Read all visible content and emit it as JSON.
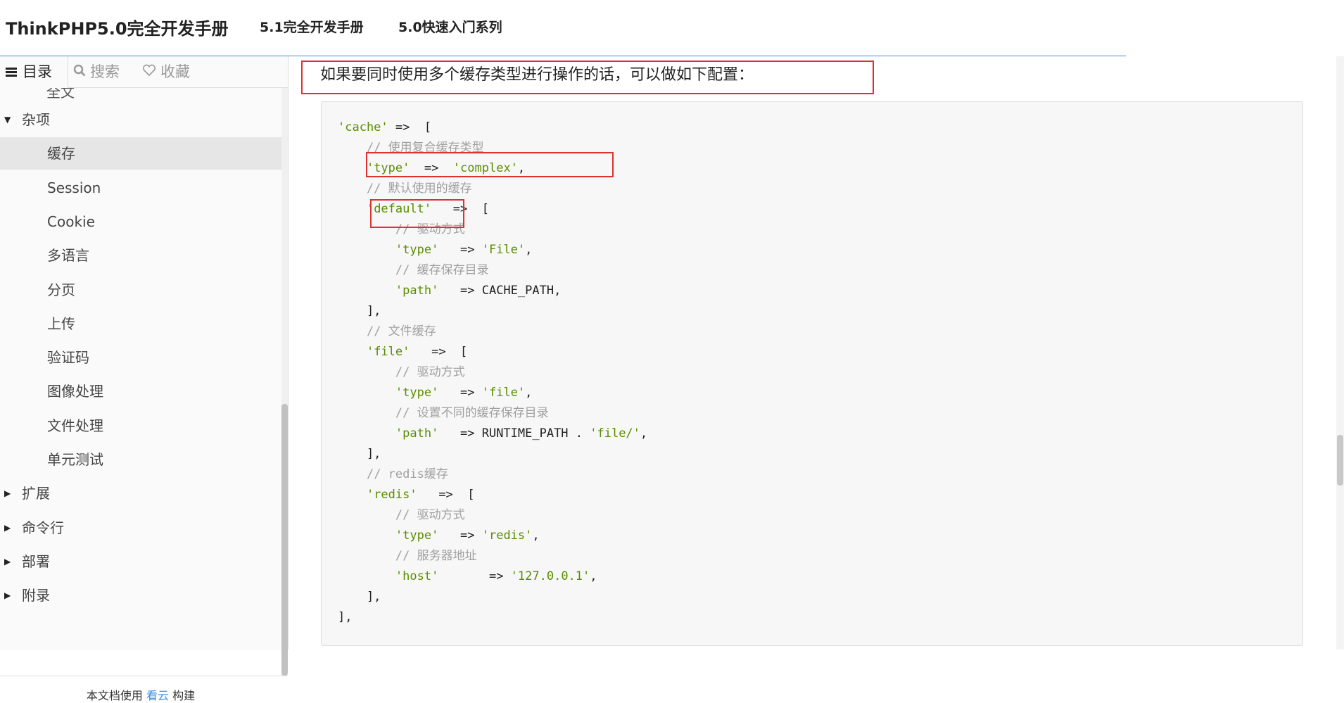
{
  "header": {
    "brand": "ThinkPHP5.0完全开发手册",
    "nav": [
      "5.1完全开发手册",
      "5.0快速入门系列"
    ]
  },
  "sidebar": {
    "tabs": [
      {
        "icon": "list-icon",
        "label": "目录"
      },
      {
        "icon": "search-icon",
        "label": "搜索"
      },
      {
        "icon": "heart-icon",
        "label": "收藏"
      }
    ],
    "partial_item": "全文",
    "items": [
      {
        "label": "杂项",
        "level": 0,
        "expanded": true
      },
      {
        "label": "缓存",
        "level": 1,
        "selected": true
      },
      {
        "label": "Session",
        "level": 1
      },
      {
        "label": "Cookie",
        "level": 1
      },
      {
        "label": "多语言",
        "level": 1
      },
      {
        "label": "分页",
        "level": 1
      },
      {
        "label": "上传",
        "level": 1
      },
      {
        "label": "验证码",
        "level": 1
      },
      {
        "label": "图像处理",
        "level": 1
      },
      {
        "label": "文件处理",
        "level": 1
      },
      {
        "label": "单元测试",
        "level": 1
      },
      {
        "label": "扩展",
        "level": 0,
        "expanded": false
      },
      {
        "label": "命令行",
        "level": 0,
        "expanded": false
      },
      {
        "label": "部署",
        "level": 0,
        "expanded": false
      },
      {
        "label": "附录",
        "level": 0,
        "expanded": false
      }
    ],
    "footer": {
      "prefix": "本文档使用 ",
      "link": "看云",
      "suffix": " 构建"
    }
  },
  "content": {
    "intro": "如果要同时使用多个缓存类型进行操作的话，可以做如下配置：",
    "code": [
      [
        [
          "s",
          "'cache'"
        ],
        [
          "p",
          " =>  ["
        ]
      ],
      [
        [
          "p",
          "    "
        ],
        [
          "c",
          "// 使用复合缓存类型"
        ]
      ],
      [
        [
          "p",
          "    "
        ],
        [
          "s",
          "'type'"
        ],
        [
          "p",
          "  =>  "
        ],
        [
          "s",
          "'complex'"
        ],
        [
          "p",
          ","
        ]
      ],
      [
        [
          "p",
          "    "
        ],
        [
          "c",
          "// 默认使用的缓存"
        ]
      ],
      [
        [
          "p",
          "    "
        ],
        [
          "s",
          "'default'"
        ],
        [
          "p",
          "   =>  ["
        ]
      ],
      [
        [
          "p",
          "        "
        ],
        [
          "c",
          "// 驱动方式"
        ]
      ],
      [
        [
          "p",
          "        "
        ],
        [
          "s",
          "'type'"
        ],
        [
          "p",
          "   => "
        ],
        [
          "s",
          "'File'"
        ],
        [
          "p",
          ","
        ]
      ],
      [
        [
          "p",
          "        "
        ],
        [
          "c",
          "// 缓存保存目录"
        ]
      ],
      [
        [
          "p",
          "        "
        ],
        [
          "s",
          "'path'"
        ],
        [
          "p",
          "   => CACHE_PATH,"
        ]
      ],
      [
        [
          "p",
          "    ],"
        ]
      ],
      [
        [
          "p",
          "    "
        ],
        [
          "c",
          "// 文件缓存"
        ]
      ],
      [
        [
          "p",
          "    "
        ],
        [
          "s",
          "'file'"
        ],
        [
          "p",
          "   =>  ["
        ]
      ],
      [
        [
          "p",
          "        "
        ],
        [
          "c",
          "// 驱动方式"
        ]
      ],
      [
        [
          "p",
          "        "
        ],
        [
          "s",
          "'type'"
        ],
        [
          "p",
          "   => "
        ],
        [
          "s",
          "'file'"
        ],
        [
          "p",
          ","
        ]
      ],
      [
        [
          "p",
          "        "
        ],
        [
          "c",
          "// 设置不同的缓存保存目录"
        ]
      ],
      [
        [
          "p",
          "        "
        ],
        [
          "s",
          "'path'"
        ],
        [
          "p",
          "   => RUNTIME_PATH . "
        ],
        [
          "s",
          "'file/'"
        ],
        [
          "p",
          ","
        ]
      ],
      [
        [
          "p",
          "    ],"
        ]
      ],
      [
        [
          "p",
          "    "
        ],
        [
          "c",
          "// redis缓存"
        ]
      ],
      [
        [
          "p",
          "    "
        ],
        [
          "s",
          "'redis'"
        ],
        [
          "p",
          "   =>  ["
        ]
      ],
      [
        [
          "p",
          "        "
        ],
        [
          "c",
          "// 驱动方式"
        ]
      ],
      [
        [
          "p",
          "        "
        ],
        [
          "s",
          "'type'"
        ],
        [
          "p",
          "   => "
        ],
        [
          "s",
          "'redis'"
        ],
        [
          "p",
          ","
        ]
      ],
      [
        [
          "p",
          "        "
        ],
        [
          "c",
          "// 服务器地址"
        ]
      ],
      [
        [
          "p",
          "        "
        ],
        [
          "s",
          "'host'"
        ],
        [
          "p",
          "       => "
        ],
        [
          "s",
          "'127.0.0.1'"
        ],
        [
          "p",
          ","
        ]
      ],
      [
        [
          "p",
          "    ],"
        ]
      ],
      [
        [
          "p",
          "],"
        ]
      ]
    ]
  },
  "colors": {
    "accent": "#3a8ee6",
    "highlight_box": "#e03131",
    "code_string": "#5a8d00",
    "code_comment": "#a0a0a0"
  }
}
